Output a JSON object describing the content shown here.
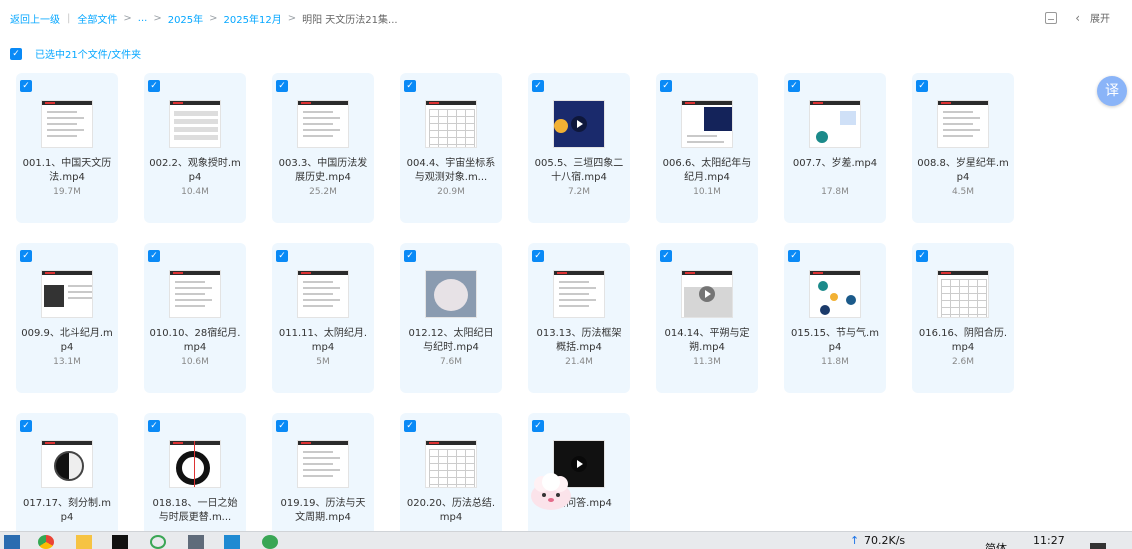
{
  "header": {
    "back_label": "返回上一级",
    "all_files_label": "全部文件",
    "ellipsis": "...",
    "crumb_year": "2025年",
    "crumb_month": "2025年12月",
    "crumb_current": "明阳 天文历法21集...",
    "expand_label": "展开"
  },
  "selection": {
    "label": "已选中21个文件/文件夹"
  },
  "files": [
    {
      "name": "001.1、中国天文历法.mp4",
      "size": "19.7M",
      "thumb": "doc"
    },
    {
      "name": "002.2、观象授时.mp4",
      "size": "10.4M",
      "thumb": "table"
    },
    {
      "name": "003.3、中国历法发展历史.mp4",
      "size": "25.2M",
      "thumb": "doc"
    },
    {
      "name": "004.4、宇宙坐标系与观测对象.m...",
      "size": "20.9M",
      "thumb": "grid"
    },
    {
      "name": "005.5、三垣四象二十八宿.mp4",
      "size": "7.2M",
      "thumb": "star"
    },
    {
      "name": "006.6、太阳纪年与纪月.mp4",
      "size": "10.1M",
      "thumb": "night"
    },
    {
      "name": "007.7、岁差.mp4",
      "size": "17.8M",
      "thumb": "diagram"
    },
    {
      "name": "008.8、岁星纪年.mp4",
      "size": "4.5M",
      "thumb": "doc"
    },
    {
      "name": "009.9、北斗纪月.mp4",
      "size": "13.1M",
      "thumb": "darksq"
    },
    {
      "name": "010.10、28宿纪月.mp4",
      "size": "10.6M",
      "thumb": "doc"
    },
    {
      "name": "011.11、太阴纪月.mp4",
      "size": "5M",
      "thumb": "doc"
    },
    {
      "name": "012.12、太阳纪日与纪时.mp4",
      "size": "7.6M",
      "thumb": "photo"
    },
    {
      "name": "013.13、历法框架概括.mp4",
      "size": "21.4M",
      "thumb": "doc"
    },
    {
      "name": "014.14、平朔与定朔.mp4",
      "size": "11.3M",
      "thumb": "gray"
    },
    {
      "name": "015.15、节与气.mp4",
      "size": "11.8M",
      "thumb": "orbit"
    },
    {
      "name": "016.16、阴阳合历.mp4",
      "size": "2.6M",
      "thumb": "grid"
    },
    {
      "name": "017.17、刻分制.mp4",
      "size": "",
      "thumb": "taiji"
    },
    {
      "name": "018.18、一日之始与时辰更替.m...",
      "size": "",
      "thumb": "circle"
    },
    {
      "name": "019.19、历法与天文周期.mp4",
      "size": "",
      "thumb": "doc"
    },
    {
      "name": "020.20、历法总结.mp4",
      "size": "",
      "thumb": "grid"
    },
    {
      "name": "课后问答.mp4",
      "size": "",
      "thumb": "black"
    }
  ],
  "translate_badge": "译",
  "taskbar": {
    "net_speed": "70.2K/s",
    "ime_text": "简体",
    "clock": "11:27"
  },
  "colors": {
    "accent": "#06a7ff",
    "card_bg": "#eef7fe",
    "checkbox": "#0a8af6"
  }
}
